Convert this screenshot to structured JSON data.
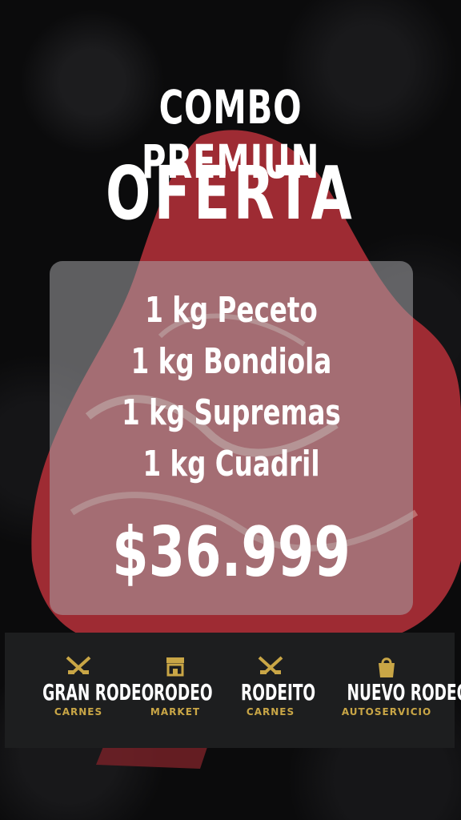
{
  "headline": {
    "line1": "COMBO PREMIUN",
    "line2": "OFERTA"
  },
  "items": [
    "1 kg Peceto",
    "1 kg Bondiola",
    "1 kg Supremas",
    "1 kg Cuadril"
  ],
  "price": "$36.999",
  "brands": [
    {
      "name": "GRAN RODEO",
      "sub": "CARNES",
      "icon": "crossed-knives-icon"
    },
    {
      "name": "RODEO",
      "sub": "MARKET",
      "icon": "storefront-icon"
    },
    {
      "name": "RODEITO",
      "sub": "CARNES",
      "icon": "crossed-knives-icon"
    },
    {
      "name": "NUEVO RODEO",
      "sub": "AUTOSERVICIO",
      "icon": "shopping-bag-icon"
    }
  ],
  "colors": {
    "accent": "#c9a646",
    "panel": "#aaaaaf",
    "text": "#ffffff",
    "background": "#0b0b0c",
    "meat": "#9e2b33"
  }
}
